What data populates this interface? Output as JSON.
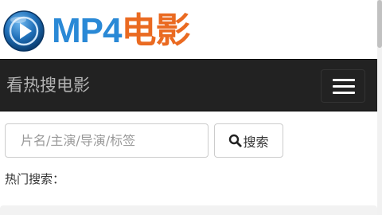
{
  "logo": {
    "icon": "play-circle-icon",
    "text_primary": "MP4",
    "text_accent": "电影",
    "colors": {
      "primary": "#2a89d6",
      "accent": "#ea6a21",
      "icon_blue": "#1f6fb8"
    }
  },
  "navbar": {
    "brand": "看热搜电影",
    "menu_icon": "hamburger-menu-icon",
    "background": "#222222"
  },
  "search": {
    "placeholder": "片名/主演/导演/标签",
    "value": "",
    "button_label": "搜索",
    "button_icon": "search-icon"
  },
  "hot": {
    "label": "热门搜索："
  }
}
